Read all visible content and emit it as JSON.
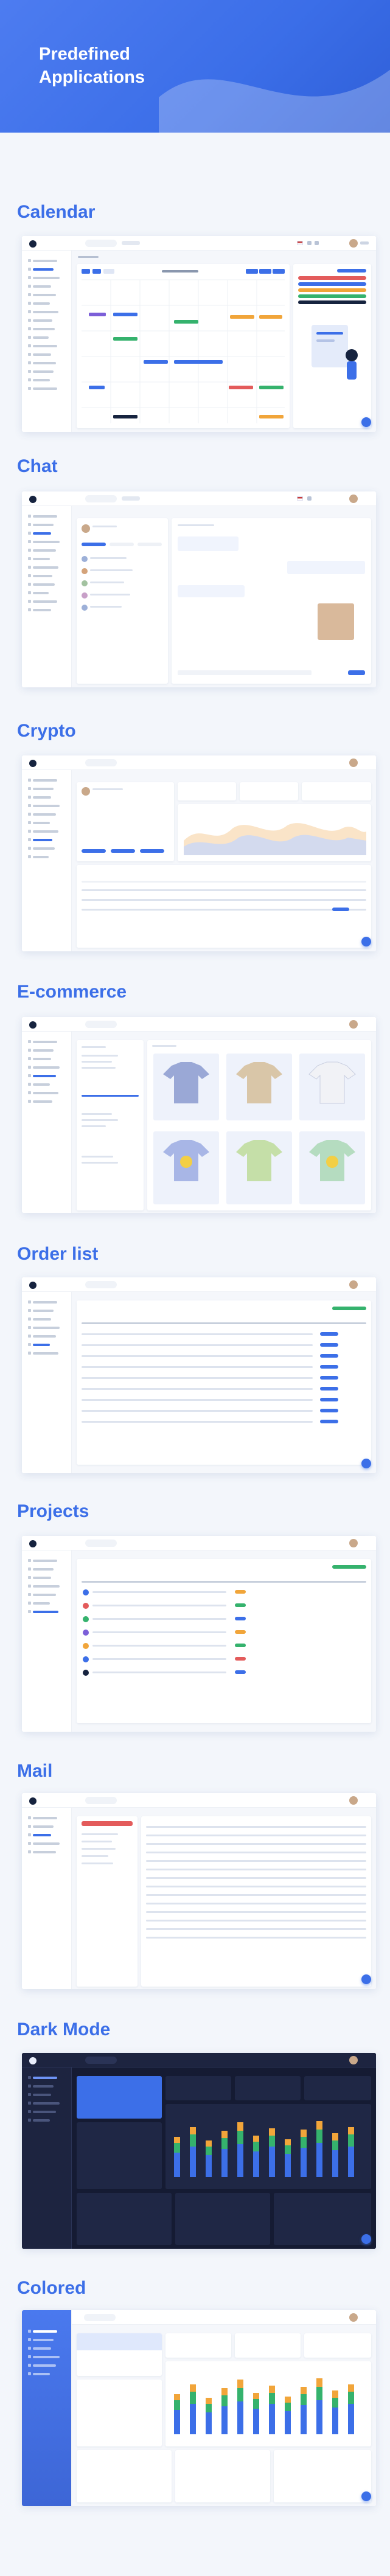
{
  "hero": {
    "title": "Predefined\nApplications"
  },
  "sections": [
    {
      "id": "calendar",
      "title": "Calendar"
    },
    {
      "id": "chat",
      "title": "Chat"
    },
    {
      "id": "crypto",
      "title": "Crypto"
    },
    {
      "id": "ecommerce",
      "title": "E-commerce"
    },
    {
      "id": "orders",
      "title": "Order list"
    },
    {
      "id": "projects",
      "title": "Projects"
    },
    {
      "id": "mail",
      "title": "Mail"
    },
    {
      "id": "dark",
      "title": "Dark Mode"
    },
    {
      "id": "colored",
      "title": "Colored"
    }
  ],
  "colors": {
    "accent": "#3c6fe8",
    "hero": "#4d7cf0",
    "dark_bg": "#1d2440",
    "success": "#35b26d",
    "warning": "#f1a53a",
    "danger": "#e35b5b"
  },
  "icons": [
    "search-icon",
    "apps-icon",
    "flag-icon",
    "bell-icon",
    "avatar-icon",
    "plus-icon"
  ]
}
